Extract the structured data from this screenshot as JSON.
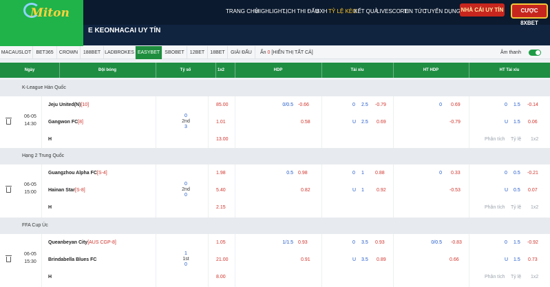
{
  "header": {
    "logo_text": "Miton",
    "nav": [
      {
        "label": "TRANG CHỦ",
        "active": false
      },
      {
        "label": "HIGHLIGHT",
        "active": false
      },
      {
        "label": "LỊCH THI ĐẤU",
        "active": false
      },
      {
        "label": "BXH",
        "active": false
      },
      {
        "label": "TỶ LỆ KÈO",
        "active": true
      },
      {
        "label": "KẾT QUẢ",
        "active": false
      },
      {
        "label": "LIVESCORE",
        "active": false
      },
      {
        "label": "TIN TỨC",
        "active": false
      },
      {
        "label": "TUYỂN DỤNG",
        "active": false
      }
    ],
    "home_button": "NHÀ CÁI UY TÍN",
    "bet_button": "CƯỢC 8XBET",
    "page_title": "E KEONHACAI UY TÍN"
  },
  "bookmakers": {
    "tabs": [
      {
        "label": "MACAUSLOT",
        "active": false
      },
      {
        "label": "BET365",
        "active": false
      },
      {
        "label": "CROWN",
        "active": false
      },
      {
        "label": "188BET",
        "active": false
      },
      {
        "label": "LADBROKES",
        "active": false
      },
      {
        "label": "EASYBET",
        "active": true
      },
      {
        "label": "SBOBET",
        "active": false
      },
      {
        "label": "12BET",
        "active": false
      },
      {
        "label": "18BET",
        "active": false
      },
      {
        "label": "GIẢI ĐẤU",
        "active": false
      }
    ],
    "hidden_label": "Ẩn",
    "hidden_count": "0",
    "show_all": "[HIỂN THỊ TẤT CẢ]",
    "sound_label": "Âm thanh",
    "sound_on": true
  },
  "columns": [
    "Ngày",
    "Đội bóng",
    "Tỷ số",
    "1x2",
    "HDP",
    "Tài xỉu",
    "HT HDP",
    "HT Tài xỉu"
  ],
  "links": {
    "analysis": "Phân tích",
    "odds": "Tỷ lệ",
    "x12": "1x2"
  },
  "leagues": [
    {
      "name": "K-League Hàn Quốc",
      "match": {
        "date": "06-05",
        "time": "14:30",
        "home": "Jeju United(N)",
        "home_rank": "[10]",
        "away": "Gangwon FC",
        "away_rank": "[8]",
        "draw_label": "H",
        "score_home": "0",
        "score_status": "2nd",
        "score_away": "3",
        "x12": [
          "85.00",
          "1.01",
          "13.00"
        ],
        "hdp_line": "0/0.5",
        "hdp": [
          "-0.66",
          "0.58"
        ],
        "ou": {
          "o_label": "0",
          "line": "2.5",
          "u_label": "U",
          "line2": "2.5",
          "odds": [
            "-0.79",
            "0.69"
          ]
        },
        "ht_hdp": {
          "line": "0",
          "odds": [
            "0.69",
            "-0.79"
          ]
        },
        "ht_ou": {
          "o_label": "0",
          "line": "1.5",
          "u_label": "U",
          "line2": "1.5",
          "odds": [
            "-0.14",
            "0.06"
          ]
        }
      }
    },
    {
      "name": "Hạng 2 Trung Quốc",
      "match": {
        "date": "06-05",
        "time": "15:00",
        "home": "Guangzhou Alpha FC",
        "home_rank": "[S-4]",
        "away": "Hainan Star",
        "away_rank": "[S-8]",
        "draw_label": "H",
        "score_home": "0",
        "score_status": "2nd",
        "score_away": "0",
        "x12": [
          "1.98",
          "5.40",
          "2.15"
        ],
        "hdp_line": "0.5",
        "hdp": [
          "0.98",
          "0.82"
        ],
        "ou": {
          "o_label": "0",
          "line": "1",
          "u_label": "U",
          "line2": "1",
          "odds": [
            "0.88",
            "0.92"
          ]
        },
        "ht_hdp": {
          "line": "0",
          "odds": [
            "0.33",
            "-0.53"
          ]
        },
        "ht_ou": {
          "o_label": "0",
          "line": "0.5",
          "u_label": "U",
          "line2": "0.5",
          "odds": [
            "-0.21",
            "0.07"
          ]
        }
      }
    },
    {
      "name": "FFA Cup Úc",
      "match": {
        "date": "06-05",
        "time": "15:30",
        "home": "Queanbeyan City",
        "home_rank": "[AUS CGP-8]",
        "away": "Brindabella Blues FC",
        "away_rank": "",
        "draw_label": "H",
        "score_home": "1",
        "score_status": "1st",
        "score_away": "0",
        "x12": [
          "1.05",
          "21.00",
          "8.00"
        ],
        "hdp_line": "1/1.5",
        "hdp": [
          "0.93",
          "0.91"
        ],
        "ou": {
          "o_label": "0",
          "line": "3.5",
          "u_label": "U",
          "line2": "3.5",
          "odds": [
            "0.93",
            "0.89"
          ]
        },
        "ht_hdp": {
          "line": "0/0.5",
          "odds": [
            "-0.83",
            "0.66"
          ]
        },
        "ht_ou": {
          "o_label": "0",
          "line": "1.5",
          "u_label": "U",
          "line2": "1.5",
          "odds": [
            "-0.92",
            "0.73"
          ]
        }
      }
    }
  ]
}
